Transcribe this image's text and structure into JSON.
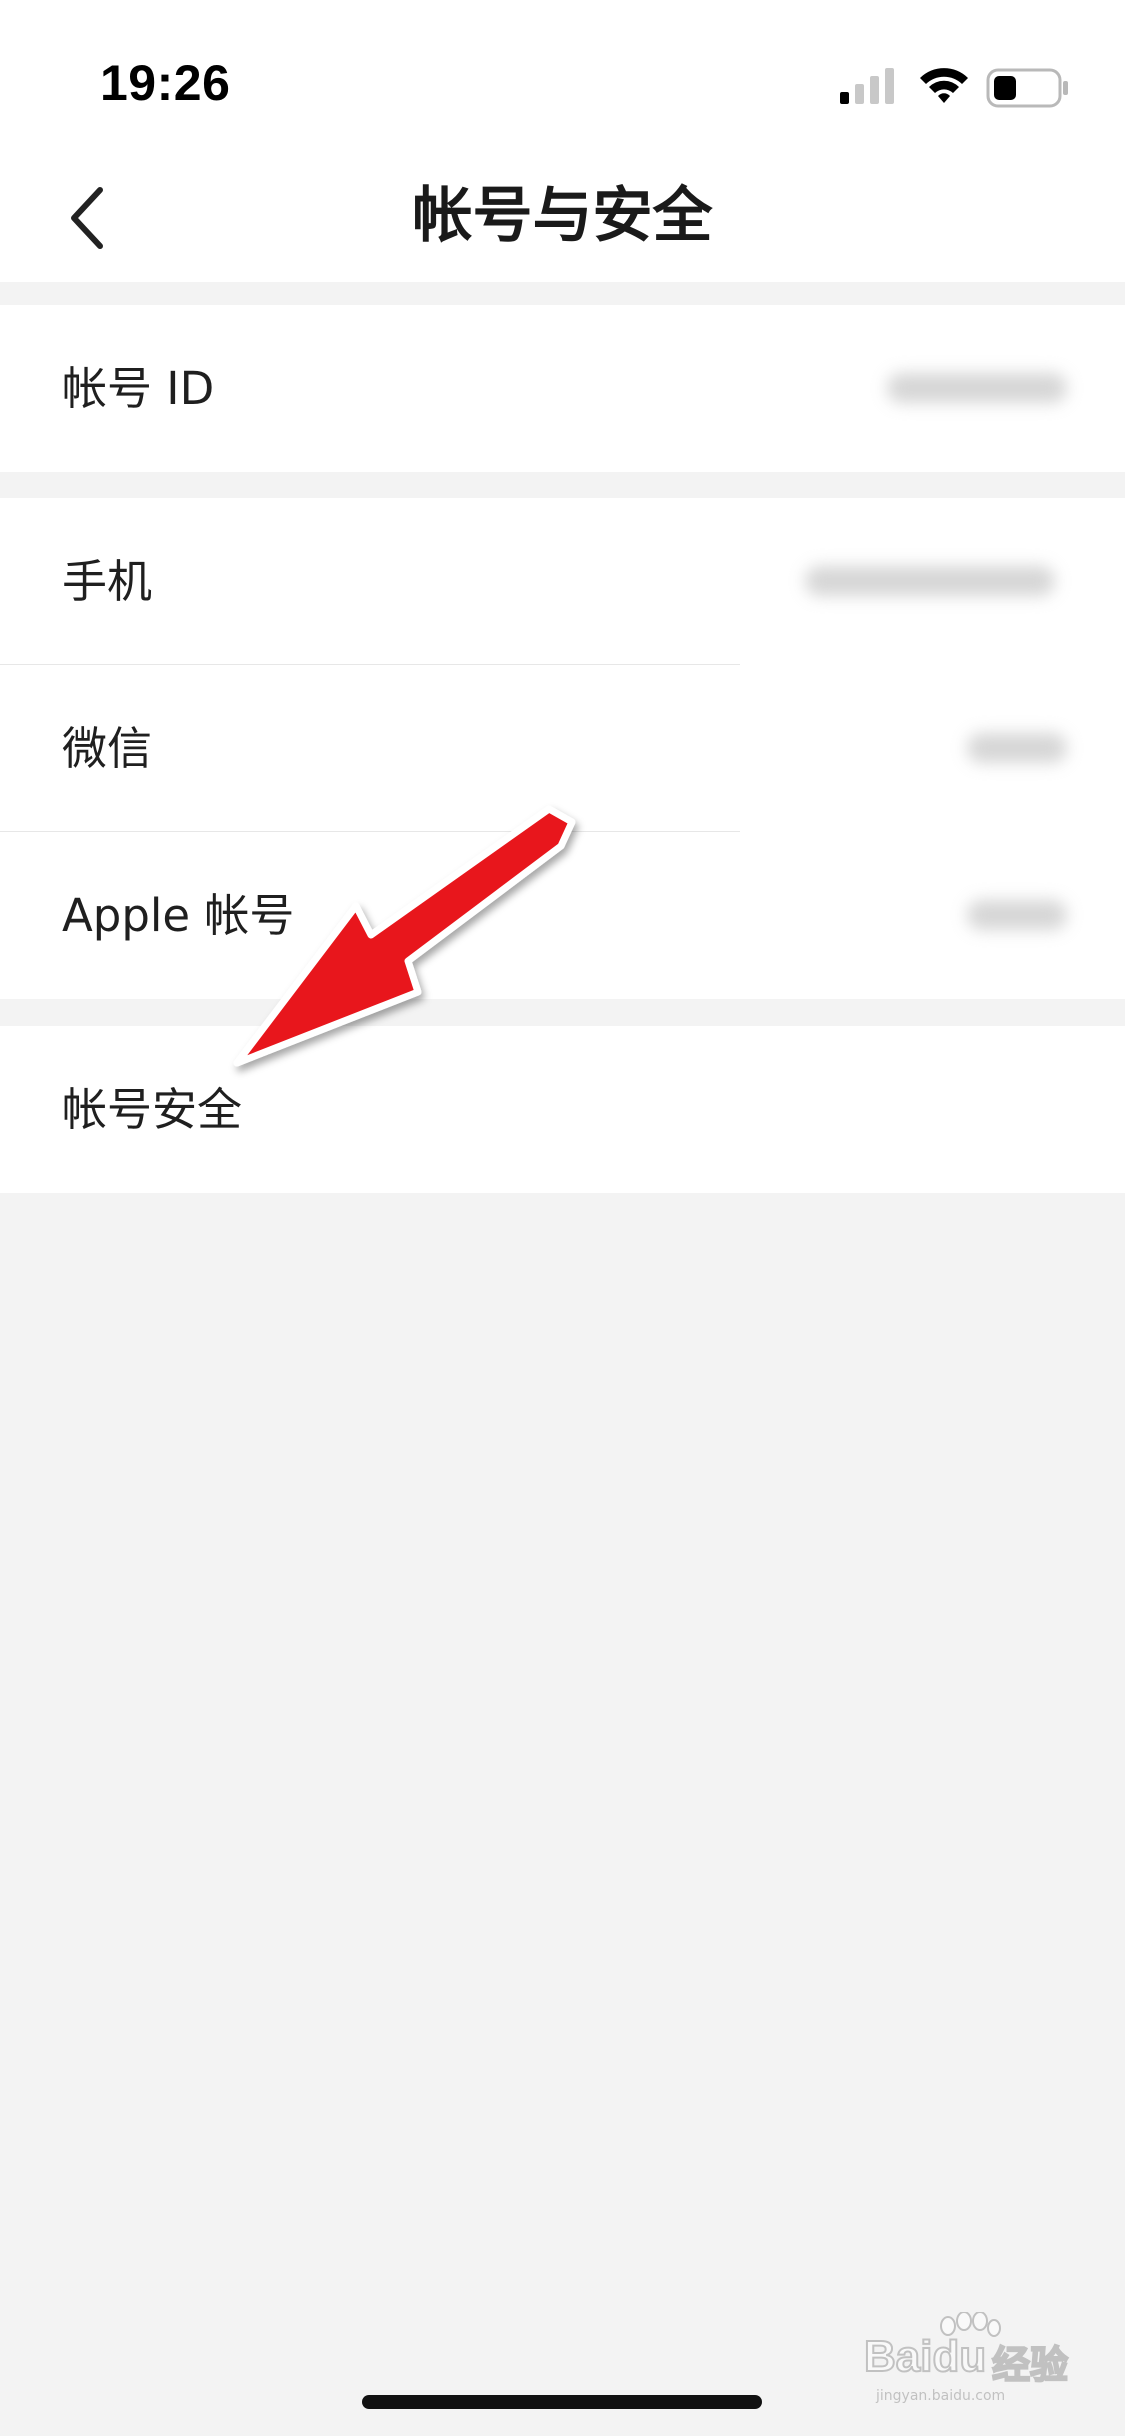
{
  "status_bar": {
    "time": "19:26"
  },
  "nav": {
    "title": "帐号与安全"
  },
  "groups": [
    {
      "rows": [
        {
          "label": "帐号 ID"
        }
      ]
    },
    {
      "rows": [
        {
          "label": "手机"
        },
        {
          "label": "微信"
        },
        {
          "label": "Apple 帐号"
        }
      ]
    },
    {
      "rows": [
        {
          "label": "帐号安全"
        }
      ]
    }
  ],
  "watermark": {
    "brand": "Baidu",
    "brand_cn": "经验",
    "url": "jingyan.baidu.com"
  },
  "colors": {
    "background": "#f3f3f3",
    "surface": "#ffffff",
    "annotation_arrow": "#e8141a"
  },
  "icons": {
    "back": "chevron-left-icon",
    "signal": "signal-icon",
    "wifi": "wifi-icon",
    "battery": "battery-icon",
    "annotation": "red-arrow-annotation"
  }
}
